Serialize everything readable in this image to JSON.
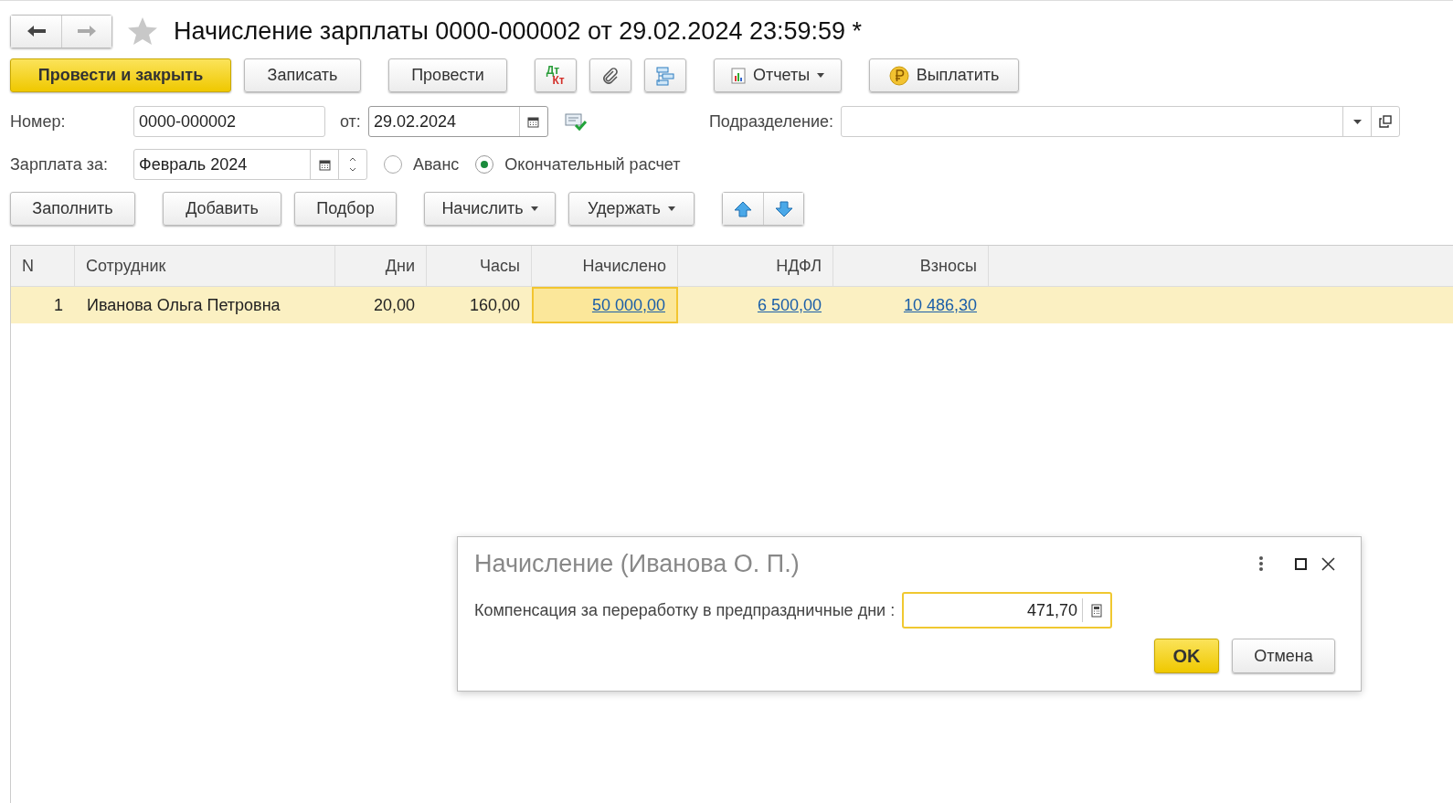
{
  "title": "Начисление зарплаты 0000-000002 от 29.02.2024 23:59:59 *",
  "toolbar": {
    "post_close": "Провести и закрыть",
    "save": "Записать",
    "post": "Провести",
    "dt": "Дт",
    "kt": "Кт",
    "reports": "Отчеты",
    "pay": "Выплатить"
  },
  "header": {
    "number_label": "Номер:",
    "number": "0000-000002",
    "date_label": "от:",
    "date": "29.02.2024",
    "division_label": "Подразделение:"
  },
  "period": {
    "label": "Зарплата за:",
    "value": "Февраль 2024",
    "options": [
      {
        "label": "Аванс",
        "selected": false
      },
      {
        "label": "Окончательный расчет",
        "selected": true
      }
    ]
  },
  "table_toolbar": [
    {
      "label": "Заполнить",
      "dropdown": false
    },
    {
      "label": "Добавить",
      "dropdown": false
    },
    {
      "label": "Подбор",
      "dropdown": false
    },
    {
      "label": "Начислить",
      "dropdown": true
    },
    {
      "label": "Удержать",
      "dropdown": true
    }
  ],
  "table": {
    "columns": [
      {
        "label": "N",
        "kind": "index"
      },
      {
        "label": "Сотрудник",
        "kind": "text"
      },
      {
        "label": "Дни",
        "kind": "number"
      },
      {
        "label": "Часы",
        "kind": "number"
      },
      {
        "label": "Начислено",
        "kind": "link"
      },
      {
        "label": "НДФЛ",
        "kind": "link"
      },
      {
        "label": "Взносы",
        "kind": "link"
      }
    ],
    "rows": [
      {
        "selected": true,
        "cells": [
          {
            "text": "1",
            "focused": false
          },
          {
            "text": "Иванова Ольга Петровна",
            "focused": false
          },
          {
            "text": "20,00",
            "focused": false
          },
          {
            "text": "160,00",
            "focused": false
          },
          {
            "text": "50 000,00",
            "focused": true
          },
          {
            "text": "6 500,00",
            "focused": false
          },
          {
            "text": "10 486,30",
            "focused": false
          }
        ]
      }
    ]
  },
  "dialog": {
    "title": "Начисление (Иванова О. П.)",
    "field_label": "Компенсация за переработку в предпраздничные дни :",
    "value": "471,70",
    "buttons": [
      {
        "label": "OK",
        "default": true
      },
      {
        "label": "Отмена",
        "default": false
      }
    ]
  }
}
